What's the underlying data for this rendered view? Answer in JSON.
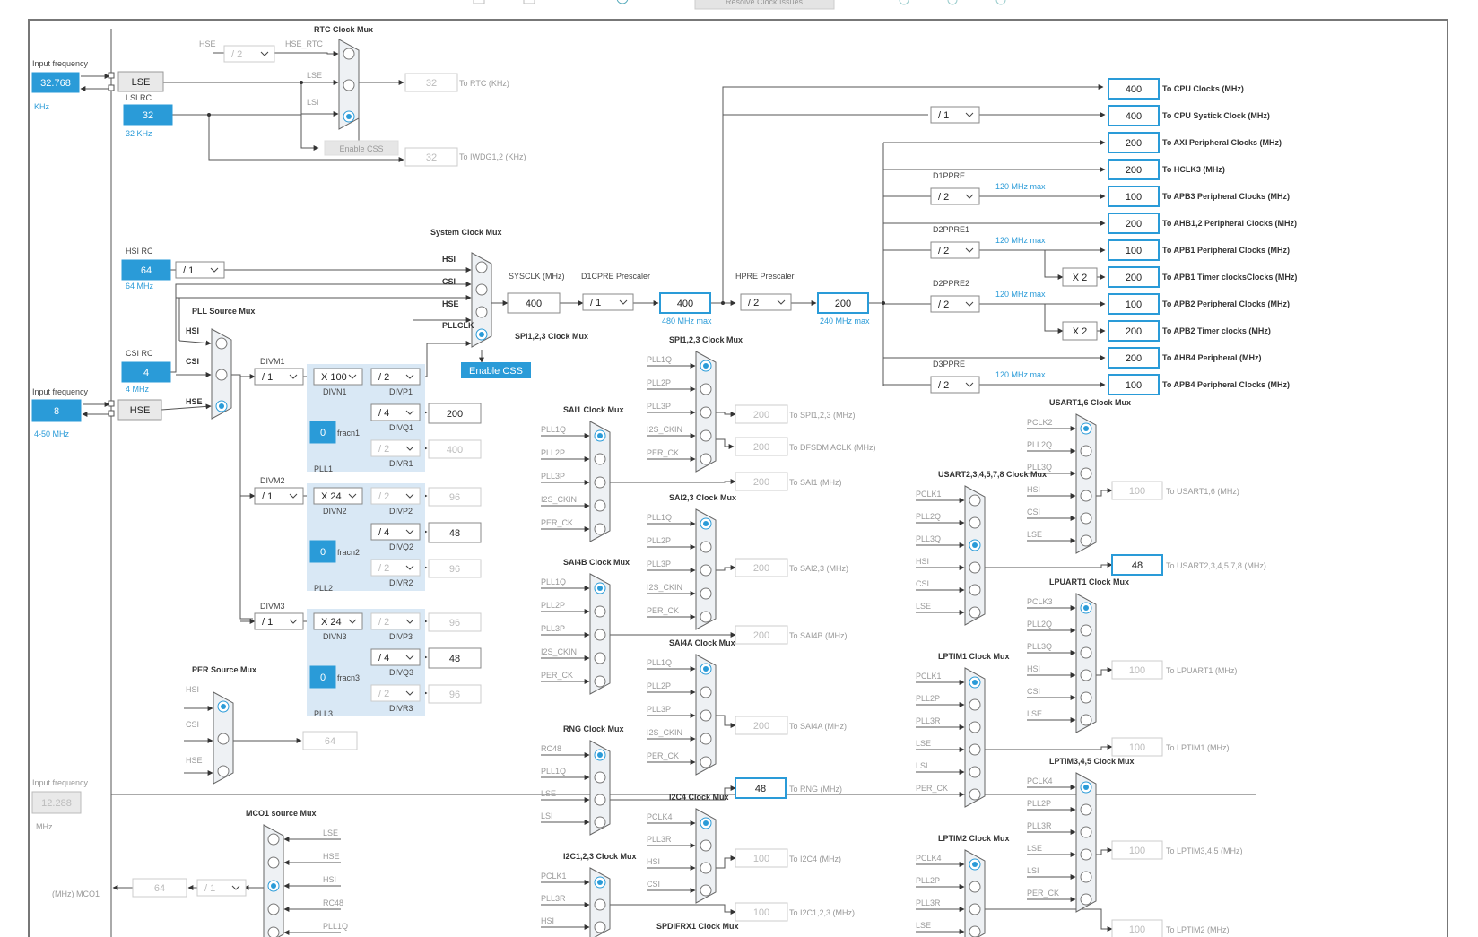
{
  "toolbar": {
    "resolve_button": "Resolve Clock Issues"
  },
  "input_freq_label": "Input frequency",
  "input_freq_unit": "MHz",
  "lse": {
    "value": "32.768",
    "unit": "KHz",
    "label": "LSE"
  },
  "lsi": {
    "title": "LSI RC",
    "value": "32",
    "sub": "32 KHz"
  },
  "hse": {
    "value": "8",
    "range": "4-50 MHz",
    "label": "HSE"
  },
  "hsi": {
    "title": "HSI RC",
    "value": "64",
    "sub": "64 MHz",
    "div": "/ 1"
  },
  "csi": {
    "title": "CSI RC",
    "value": "4",
    "sub": "4 MHz"
  },
  "mco_in": {
    "label": "Input frequency",
    "value": "12.288",
    "unit": "MHz"
  },
  "rtc": {
    "title": "RTC Clock Mux",
    "hse_div": "/ 2",
    "hse_rtc": "HSE_RTC",
    "hse": "HSE",
    "lse": "LSE",
    "lsi": "LSI",
    "out_rtc": "32",
    "to_rtc": "To RTC (KHz)",
    "out_iwdg": "32",
    "to_iwdg": "To IWDG1,2 (KHz)",
    "enable_css": "Enable CSS"
  },
  "sysmux": {
    "title": "System Clock Mux",
    "hsi": "HSI",
    "csi": "CSI",
    "hse": "HSE",
    "pllclk": "PLLCLK",
    "enable_css": "Enable CSS"
  },
  "sysclk": {
    "label": "SYSCLK (MHz)",
    "value": "400"
  },
  "d1cpre": {
    "label": "D1CPRE Prescaler",
    "div": "/ 1"
  },
  "cpu": {
    "value": "400",
    "max": "480 MHz max"
  },
  "hpre": {
    "label": "HPRE Prescaler",
    "div": "/ 2",
    "value": "200",
    "max": "240 MHz max"
  },
  "outputs": [
    {
      "value": "400",
      "label": "To CPU Clocks (MHz)"
    },
    {
      "value": "400",
      "label": "To CPU Systick Clock (MHz)",
      "div": "/ 1"
    },
    {
      "value": "200",
      "label": "To AXI Peripheral Clocks (MHz)"
    },
    {
      "value": "200",
      "label": "To HCLK3 (MHz)"
    },
    {
      "value": "100",
      "label": "To APB3 Peripheral Clocks (MHz)",
      "pre": "D1PPRE",
      "div": "/ 2",
      "max": "120 MHz max"
    },
    {
      "value": "200",
      "label": "To AHB1,2 Peripheral Clocks (MHz)"
    },
    {
      "value": "100",
      "label": "To APB1 Peripheral Clocks (MHz)",
      "pre": "D2PPRE1",
      "div": "/ 2",
      "max": "120 MHz max"
    },
    {
      "value": "200",
      "label": "To APB1 Timer clocksClocks (MHz)",
      "mul": "X 2"
    },
    {
      "value": "100",
      "label": "To APB2 Peripheral Clocks (MHz)",
      "pre": "D2PPRE2",
      "div": "/ 2",
      "max": "120 MHz max"
    },
    {
      "value": "200",
      "label": "To APB2 Timer clocks (MHz)",
      "mul": "X 2"
    },
    {
      "value": "200",
      "label": "To AHB4 Peripheral (MHz)"
    },
    {
      "value": "100",
      "label": "To APB4 Peripheral Clocks (MHz)",
      "pre": "D3PPRE",
      "div": "/ 2",
      "max": "120 MHz max"
    }
  ],
  "pllsrc": {
    "title": "PLL Source Mux",
    "hsi": "HSI",
    "csi": "CSI",
    "hse": "HSE"
  },
  "pll1": {
    "divm_label": "DIVM1",
    "divm": "/ 1",
    "divn": "X 100",
    "divn_label": "DIVN1",
    "divp": "/ 2",
    "divp_label": "DIVP1",
    "divq": "/ 4",
    "divq_label": "DIVQ1",
    "divq_out": "200",
    "divr": "/ 2",
    "divr_label": "DIVR1",
    "divr_out": "400",
    "fracn": "0",
    "fracn_label": "fracn1",
    "name": "PLL1"
  },
  "pll2": {
    "divm_label": "DIVM2",
    "divm": "/ 1",
    "divn": "X 24",
    "divn_label": "DIVN2",
    "divp": "/ 2",
    "divp_label": "DIVP2",
    "divp_out": "96",
    "divq": "/ 4",
    "divq_label": "DIVQ2",
    "divq_out": "48",
    "divr": "/ 2",
    "divr_label": "DIVR2",
    "divr_out": "96",
    "fracn": "0",
    "fracn_label": "fracn2",
    "name": "PLL2"
  },
  "pll3": {
    "divm_label": "DIVM3",
    "divm": "/ 1",
    "divn": "X 24",
    "divn_label": "DIVN3",
    "divp": "/ 2",
    "divp_label": "DIVP3",
    "divp_out": "96",
    "divq": "/ 4",
    "divq_label": "DIVQ3",
    "divq_out": "48",
    "divr": "/ 2",
    "divr_label": "DIVR3",
    "divr_out": "96",
    "fracn": "0",
    "fracn_label": "fracn3",
    "name": "PLL3"
  },
  "per_mux": {
    "title": "PER Source Mux",
    "hsi": "HSI",
    "csi": "CSI",
    "hse": "HSE",
    "out": "64"
  },
  "mco1": {
    "title": "MCO1 source Mux",
    "inputs": [
      "LSE",
      "HSE",
      "HSI",
      "RC48",
      "PLL1Q"
    ],
    "out": "64",
    "div": "/ 1",
    "label": "(MHz) MCO1"
  },
  "spi123": {
    "title": "SPI1,2,3 Clock Mux",
    "inputs": [
      "PLL1Q",
      "PLL2P",
      "PLL3P",
      "I2S_CKIN",
      "PER_CK"
    ],
    "out": "200",
    "to": "To SPI1,2,3 (MHz)"
  },
  "dfsdm": {
    "out": "200",
    "to": "To DFSDM ACLK (MHz)"
  },
  "sai1": {
    "title": "SAI1 Clock Mux",
    "inputs": [
      "PLL1Q",
      "PLL2P",
      "PLL3P",
      "I2S_CKIN",
      "PER_CK"
    ],
    "out": "200",
    "to": "To SAI1 (MHz)"
  },
  "sai23": {
    "title": "SAI2,3 Clock Mux",
    "inputs": [
      "PLL1Q",
      "PLL2P",
      "PLL3P",
      "I2S_CKIN",
      "PER_CK"
    ],
    "out": "200",
    "to": "To SAI2,3 (MHz)"
  },
  "sai4b": {
    "title": "SAI4B Clock Mux",
    "inputs": [
      "PLL1Q",
      "PLL2P",
      "PLL3P",
      "I2S_CKIN",
      "PER_CK"
    ],
    "out": "200",
    "to": "To SAI4B (MHz)"
  },
  "sai4a": {
    "title": "SAI4A Clock Mux",
    "inputs": [
      "PLL1Q",
      "PLL2P",
      "PLL3P",
      "I2S_CKIN",
      "PER_CK"
    ],
    "out": "200",
    "to": "To SAI4A (MHz)"
  },
  "rng": {
    "title": "RNG Clock Mux",
    "inputs": [
      "RC48",
      "PLL1Q",
      "LSE",
      "LSI"
    ],
    "out": "48",
    "to": "To RNG (MHz)"
  },
  "i2c4": {
    "title": "I2C4 Clock Mux",
    "inputs": [
      "PCLK4",
      "PLL3R",
      "HSI",
      "CSI"
    ],
    "out": "100",
    "to": "To I2C4 (MHz)"
  },
  "i2c123": {
    "title": "I2C1,2,3 Clock Mux",
    "inputs": [
      "PCLK1",
      "PLL3R",
      "HSI"
    ],
    "out": "100",
    "to": "To I2C1,2,3 (MHz)"
  },
  "spdif": {
    "title": "SPDIFRX1 Clock Mux"
  },
  "usart16": {
    "title": "USART1,6 Clock Mux",
    "inputs": [
      "PCLK2",
      "PLL2Q",
      "PLL3Q",
      "HSI",
      "CSI",
      "LSE"
    ],
    "out": "100",
    "to": "To USART1,6 (MHz)"
  },
  "usart2": {
    "title": "USART2,3,4,5,7,8 Clock Mux",
    "inputs": [
      "PCLK1",
      "PLL2Q",
      "PLL3Q",
      "HSI",
      "CSI",
      "LSE"
    ],
    "out": "48",
    "to": "To USART2,3,4,5,7,8 (MHz)"
  },
  "lpuart1": {
    "title": "LPUART1 Clock Mux",
    "inputs": [
      "PCLK3",
      "PLL2Q",
      "PLL3Q",
      "HSI",
      "CSI",
      "LSE"
    ],
    "out": "100",
    "to": "To LPUART1 (MHz)"
  },
  "lptim1": {
    "title": "LPTIM1 Clock Mux",
    "inputs": [
      "PCLK1",
      "PLL2P",
      "PLL3R",
      "LSE",
      "LSI",
      "PER_CK"
    ],
    "out": "100",
    "to": "To LPTIM1 (MHz)"
  },
  "lptim345": {
    "title": "LPTIM3,4,5 Clock Mux",
    "inputs": [
      "PCLK4",
      "PLL2P",
      "PLL3R",
      "LSE",
      "LSI",
      "PER_CK"
    ],
    "out": "100",
    "to": "To LPTIM3,4,5 (MHz)"
  },
  "lptim2": {
    "title": "LPTIM2 Clock Mux",
    "inputs": [
      "PCLK4",
      "PLL2P",
      "PLL3R",
      "LSE"
    ],
    "out": "100",
    "to": "To LPTIM2 (MHz)"
  },
  "colors": {
    "accent": "#2a9bd8",
    "pll_bg": "#d9e8f5",
    "line": "#555555"
  }
}
